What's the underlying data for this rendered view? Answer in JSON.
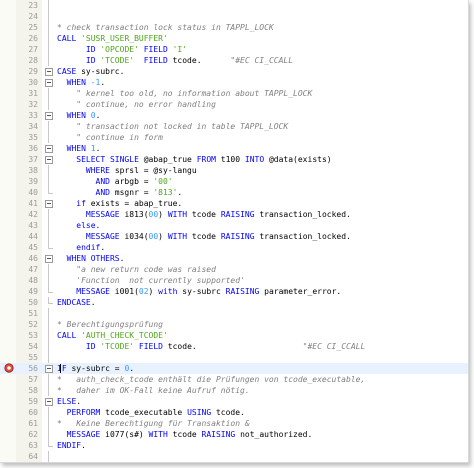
{
  "editor": {
    "colors": {
      "keyword": "#0000ff",
      "comment": "#808080",
      "string": "#4da619",
      "number": "#3399ff",
      "active_line": "#e8f2fe"
    },
    "breakpoint_icon": "breakpoint-icon",
    "lines": [
      {
        "num": "23",
        "fold": "line",
        "tokens": []
      },
      {
        "num": "24",
        "fold": "line",
        "tokens": []
      },
      {
        "num": "25",
        "fold": "line",
        "tokens": [
          {
            "t": "cm",
            "v": "* check transaction lock status in TAPPL_LOCK"
          }
        ]
      },
      {
        "num": "26",
        "fold": "line",
        "tokens": [
          {
            "t": "kw",
            "v": "CALL "
          },
          {
            "t": "str",
            "v": "'SUSR_USER_BUFFER'"
          }
        ]
      },
      {
        "num": "27",
        "fold": "line",
        "tokens": [
          {
            "t": "id",
            "v": "      "
          },
          {
            "t": "kw",
            "v": "ID "
          },
          {
            "t": "str",
            "v": "'OPCODE'"
          },
          {
            "t": "kw",
            "v": " FIELD "
          },
          {
            "t": "str",
            "v": "'I'"
          }
        ]
      },
      {
        "num": "28",
        "fold": "line",
        "tokens": [
          {
            "t": "id",
            "v": "      "
          },
          {
            "t": "kw",
            "v": "ID "
          },
          {
            "t": "str",
            "v": "'TCODE'"
          },
          {
            "t": "kw",
            "v": "  FIELD "
          },
          {
            "t": "id",
            "v": "tcode.      "
          },
          {
            "t": "cm",
            "v": "\"#EC CI_CCALL"
          }
        ]
      },
      {
        "num": "29",
        "fold": "box",
        "tokens": [
          {
            "t": "kw",
            "v": "CASE "
          },
          {
            "t": "id",
            "v": "sy-subrc."
          }
        ]
      },
      {
        "num": "30",
        "fold": "box",
        "tokens": [
          {
            "t": "id",
            "v": "  "
          },
          {
            "t": "kw",
            "v": "WHEN "
          },
          {
            "t": "num",
            "v": "-1"
          },
          {
            "t": "id",
            "v": "."
          }
        ]
      },
      {
        "num": "31",
        "fold": "line",
        "tokens": [
          {
            "t": "cm",
            "v": "    \" kernel too old, no information about TAPPL_LOCK"
          }
        ]
      },
      {
        "num": "32",
        "fold": "line",
        "tokens": [
          {
            "t": "cm",
            "v": "    \" continue, no error handling"
          }
        ]
      },
      {
        "num": "33",
        "fold": "box",
        "tokens": [
          {
            "t": "id",
            "v": "  "
          },
          {
            "t": "kw",
            "v": "WHEN "
          },
          {
            "t": "num",
            "v": "0"
          },
          {
            "t": "id",
            "v": "."
          }
        ]
      },
      {
        "num": "34",
        "fold": "line",
        "tokens": [
          {
            "t": "cm",
            "v": "    \" transaction not locked in table TAPPL_LOCK"
          }
        ]
      },
      {
        "num": "35",
        "fold": "line",
        "tokens": [
          {
            "t": "cm",
            "v": "    \" continue in form"
          }
        ]
      },
      {
        "num": "36",
        "fold": "box",
        "tokens": [
          {
            "t": "id",
            "v": "  "
          },
          {
            "t": "kw",
            "v": "WHEN "
          },
          {
            "t": "num",
            "v": "1"
          },
          {
            "t": "id",
            "v": "."
          }
        ]
      },
      {
        "num": "37",
        "fold": "box",
        "tokens": [
          {
            "t": "id",
            "v": "    "
          },
          {
            "t": "kw",
            "v": "SELECT SINGLE "
          },
          {
            "t": "id",
            "v": "@abap_true "
          },
          {
            "t": "kw",
            "v": "FROM "
          },
          {
            "t": "id",
            "v": "t100 "
          },
          {
            "t": "kw",
            "v": "INTO "
          },
          {
            "t": "id",
            "v": "@data(exists)"
          }
        ]
      },
      {
        "num": "38",
        "fold": "line",
        "tokens": [
          {
            "t": "id",
            "v": "      "
          },
          {
            "t": "kw",
            "v": "WHERE "
          },
          {
            "t": "id",
            "v": "sprsl = @sy-langu"
          }
        ]
      },
      {
        "num": "39",
        "fold": "line",
        "tokens": [
          {
            "t": "id",
            "v": "        "
          },
          {
            "t": "kw",
            "v": "AND "
          },
          {
            "t": "id",
            "v": "arbgb = "
          },
          {
            "t": "str",
            "v": "'00'"
          }
        ]
      },
      {
        "num": "40",
        "fold": "end",
        "tokens": [
          {
            "t": "id",
            "v": "        "
          },
          {
            "t": "kw",
            "v": "AND "
          },
          {
            "t": "id",
            "v": "msgnr = "
          },
          {
            "t": "str",
            "v": "'813'"
          },
          {
            "t": "id",
            "v": "."
          }
        ]
      },
      {
        "num": "41",
        "fold": "box",
        "tokens": [
          {
            "t": "id",
            "v": "    "
          },
          {
            "t": "kw",
            "v": "if "
          },
          {
            "t": "id",
            "v": "exists = abap_true."
          }
        ]
      },
      {
        "num": "42",
        "fold": "line",
        "tokens": [
          {
            "t": "id",
            "v": "      "
          },
          {
            "t": "kw",
            "v": "MESSAGE "
          },
          {
            "t": "id",
            "v": "i813("
          },
          {
            "t": "num",
            "v": "00"
          },
          {
            "t": "id",
            "v": ") "
          },
          {
            "t": "kw",
            "v": "WITH "
          },
          {
            "t": "id",
            "v": "tcode "
          },
          {
            "t": "kw",
            "v": "RAISING "
          },
          {
            "t": "id",
            "v": "transaction_locked."
          }
        ]
      },
      {
        "num": "43",
        "fold": "line",
        "tokens": [
          {
            "t": "id",
            "v": "    "
          },
          {
            "t": "kw",
            "v": "else"
          },
          {
            "t": "id",
            "v": "."
          }
        ]
      },
      {
        "num": "44",
        "fold": "line",
        "tokens": [
          {
            "t": "id",
            "v": "      "
          },
          {
            "t": "kw",
            "v": "MESSAGE "
          },
          {
            "t": "id",
            "v": "i034("
          },
          {
            "t": "num",
            "v": "00"
          },
          {
            "t": "id",
            "v": ") "
          },
          {
            "t": "kw",
            "v": "WITH "
          },
          {
            "t": "id",
            "v": "tcode "
          },
          {
            "t": "kw",
            "v": "RAISING "
          },
          {
            "t": "id",
            "v": "transaction_locked."
          }
        ]
      },
      {
        "num": "45",
        "fold": "end",
        "tokens": [
          {
            "t": "id",
            "v": "    "
          },
          {
            "t": "kw",
            "v": "endif"
          },
          {
            "t": "id",
            "v": "."
          }
        ]
      },
      {
        "num": "46",
        "fold": "box",
        "tokens": [
          {
            "t": "id",
            "v": "  "
          },
          {
            "t": "kw",
            "v": "WHEN OTHERS"
          },
          {
            "t": "id",
            "v": "."
          }
        ]
      },
      {
        "num": "47",
        "fold": "line",
        "tokens": [
          {
            "t": "cm",
            "v": "    \"a new return code was raised"
          }
        ]
      },
      {
        "num": "48",
        "fold": "line",
        "tokens": [
          {
            "t": "cm",
            "v": "    'Function  not currently supported'"
          }
        ]
      },
      {
        "num": "49",
        "fold": "end",
        "tokens": [
          {
            "t": "id",
            "v": "    "
          },
          {
            "t": "kw",
            "v": "MESSAGE "
          },
          {
            "t": "id",
            "v": "i001("
          },
          {
            "t": "num",
            "v": "02"
          },
          {
            "t": "id",
            "v": ") "
          },
          {
            "t": "kw",
            "v": "with "
          },
          {
            "t": "id",
            "v": "sy-subrc "
          },
          {
            "t": "kw",
            "v": "RAISING "
          },
          {
            "t": "id",
            "v": "parameter_error."
          }
        ]
      },
      {
        "num": "50",
        "fold": "end",
        "tokens": [
          {
            "t": "kw",
            "v": "ENDCASE"
          },
          {
            "t": "id",
            "v": "."
          }
        ]
      },
      {
        "num": "51",
        "fold": "line",
        "tokens": []
      },
      {
        "num": "52",
        "fold": "line",
        "tokens": [
          {
            "t": "cm",
            "v": "* Berechtigungsprüfung"
          }
        ]
      },
      {
        "num": "53",
        "fold": "line",
        "tokens": [
          {
            "t": "kw",
            "v": "CALL "
          },
          {
            "t": "str",
            "v": "'AUTH_CHECK_TCODE'"
          }
        ]
      },
      {
        "num": "54",
        "fold": "line",
        "tokens": [
          {
            "t": "id",
            "v": "      "
          },
          {
            "t": "kw",
            "v": "ID "
          },
          {
            "t": "str",
            "v": "'TCODE'"
          },
          {
            "t": "kw",
            "v": " FIELD "
          },
          {
            "t": "id",
            "v": "tcode.                      "
          },
          {
            "t": "cm",
            "v": "\"#EC CI_CCALL"
          }
        ]
      },
      {
        "num": "55",
        "fold": "line",
        "tokens": []
      },
      {
        "num": "56",
        "fold": "box",
        "active": true,
        "breakpoint": true,
        "tokens": [
          {
            "t": "kw",
            "v": "IF "
          },
          {
            "t": "id",
            "v": "sy-subrc = "
          },
          {
            "t": "num",
            "v": "0"
          },
          {
            "t": "id",
            "v": "."
          }
        ]
      },
      {
        "num": "57",
        "fold": "line",
        "tokens": [
          {
            "t": "cm",
            "v": "*   auth_check_tcode enthält die Prüfungen von tcode_executable,"
          }
        ]
      },
      {
        "num": "58",
        "fold": "line",
        "tokens": [
          {
            "t": "cm",
            "v": "*   daher im OK-Fall keine Aufruf nötig."
          }
        ]
      },
      {
        "num": "59",
        "fold": "box",
        "tokens": [
          {
            "t": "kw",
            "v": "ELSE"
          },
          {
            "t": "id",
            "v": "."
          }
        ]
      },
      {
        "num": "60",
        "fold": "line",
        "tokens": [
          {
            "t": "id",
            "v": "  "
          },
          {
            "t": "kw",
            "v": "PERFORM "
          },
          {
            "t": "id",
            "v": "tcode_executable "
          },
          {
            "t": "kw",
            "v": "USING "
          },
          {
            "t": "id",
            "v": "tcode."
          }
        ]
      },
      {
        "num": "61",
        "fold": "line",
        "tokens": [
          {
            "t": "cm",
            "v": "*   Keine Berechtigung für Transaktion &"
          }
        ]
      },
      {
        "num": "62",
        "fold": "line",
        "tokens": [
          {
            "t": "id",
            "v": "  "
          },
          {
            "t": "kw",
            "v": "MESSAGE "
          },
          {
            "t": "id",
            "v": "i077(s#) "
          },
          {
            "t": "kw",
            "v": "WITH "
          },
          {
            "t": "id",
            "v": "tcode "
          },
          {
            "t": "kw",
            "v": "RAISING "
          },
          {
            "t": "id",
            "v": "not_authorized."
          }
        ]
      },
      {
        "num": "63",
        "fold": "end",
        "tokens": [
          {
            "t": "kw",
            "v": "ENDIF"
          },
          {
            "t": "id",
            "v": "."
          }
        ]
      },
      {
        "num": "64",
        "fold": "line",
        "tokens": []
      },
      {
        "num": "65",
        "fold": "end",
        "tokens": [
          {
            "t": "kw",
            "v": "ENDFUNCTION"
          },
          {
            "t": "id",
            "v": "."
          }
        ]
      }
    ]
  }
}
